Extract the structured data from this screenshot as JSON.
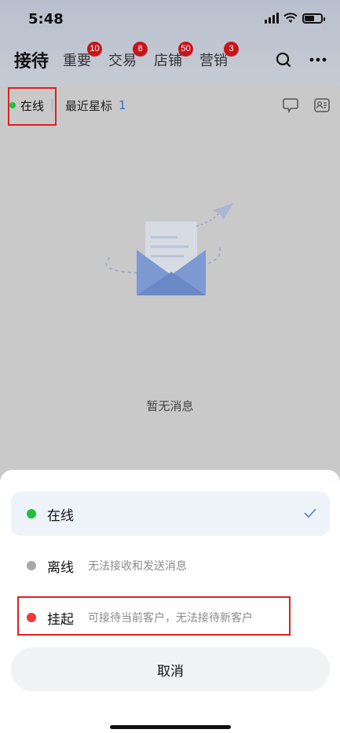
{
  "status_bar": {
    "time": "5:48"
  },
  "header": {
    "title": "接待",
    "tabs": [
      {
        "label": "重要",
        "badge": "10"
      },
      {
        "label": "交易",
        "badge": "8"
      },
      {
        "label": "店铺",
        "badge": "50"
      },
      {
        "label": "营销",
        "badge": "3"
      }
    ],
    "search_icon": "search-icon",
    "more_icon": "more-icon"
  },
  "subbar": {
    "status_label": "在线",
    "status_color": "#1fbf3a",
    "recent_label": "最近星标",
    "recent_count": "1"
  },
  "empty_state": {
    "text": "暂无消息"
  },
  "sheet": {
    "options": [
      {
        "label": "在线",
        "desc": "",
        "color": "#1fbf3a",
        "selected": true
      },
      {
        "label": "离线",
        "desc": "无法接收和发送消息",
        "color": "#a7a7a7",
        "selected": false
      },
      {
        "label": "挂起",
        "desc": "可接待当前客户，无法接待新客户",
        "color": "#ee3a3a",
        "selected": false
      }
    ],
    "cancel_label": "取消"
  },
  "colors": {
    "accent": "#2f6fd6",
    "highlight_box": "#e02020"
  }
}
